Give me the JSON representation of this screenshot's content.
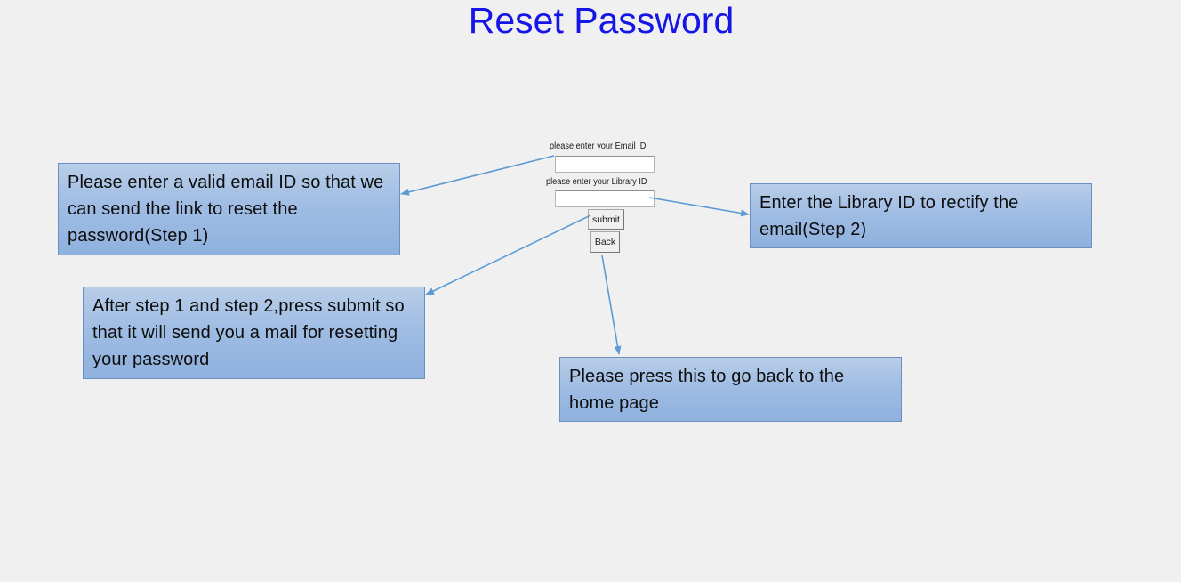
{
  "page": {
    "title": "Reset Password"
  },
  "form": {
    "email_label": "please enter your Email ID",
    "email_value": "",
    "library_label": "please enter your Library ID",
    "library_value": "",
    "submit_label": "submit",
    "back_label": "Back"
  },
  "callouts": {
    "email_note": "Please enter a valid email ID so that we can send the link to reset the password(Step 1)",
    "library_note": "Enter the Library ID to  rectify the email(Step 2)",
    "submit_note": "After step 1 and step 2,press submit so that it will send you a mail  for resetting your password",
    "back_note": "Please press this to go back to the home page"
  },
  "colors": {
    "title": "#1515e6",
    "callout_fill": "#9ebbe3",
    "callout_border": "#6a8fc2",
    "arrow": "#5b9bd5",
    "background": "#f0f0f0"
  }
}
